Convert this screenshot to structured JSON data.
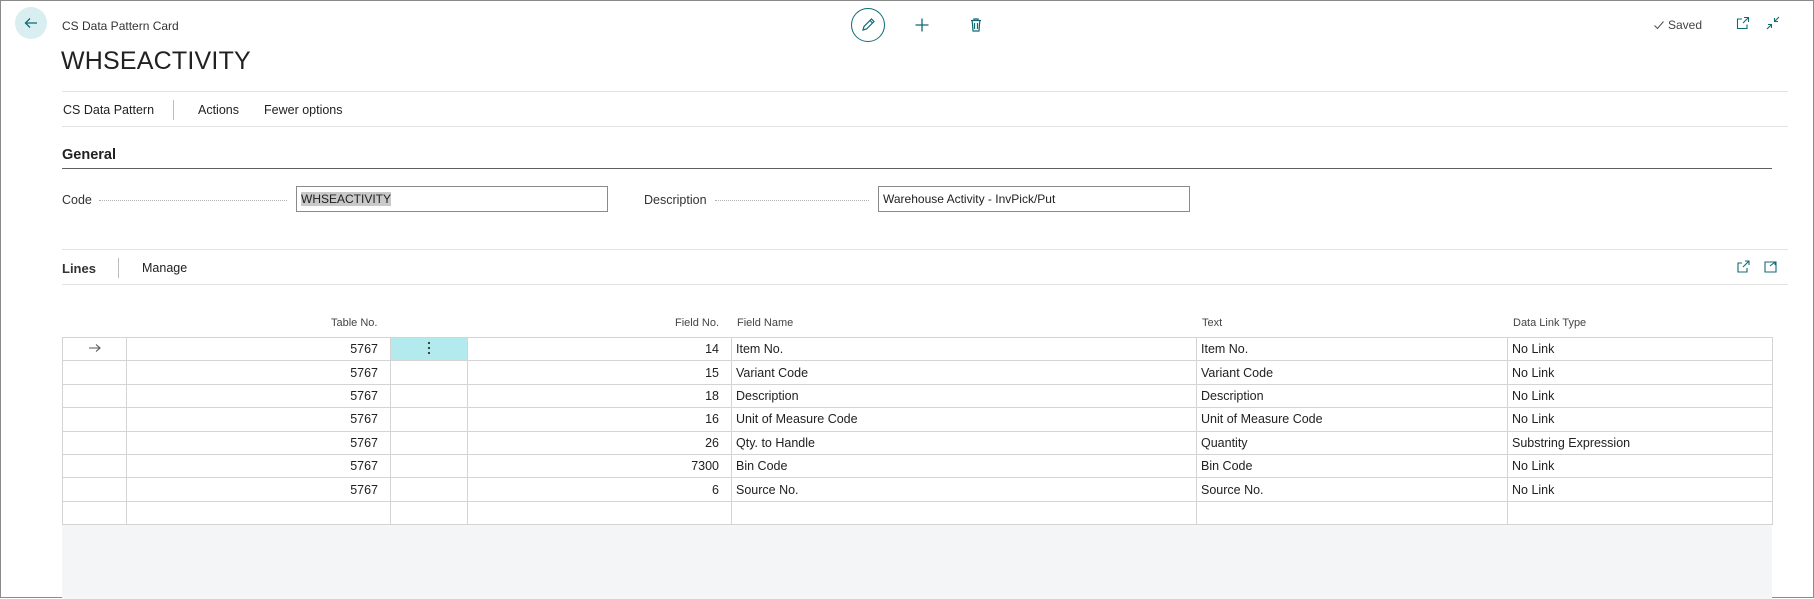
{
  "header": {
    "caption": "CS Data Pattern Card",
    "title": "WHSEACTIVITY",
    "status": "Saved"
  },
  "menu": {
    "items": [
      "CS Data Pattern",
      "Actions",
      "Fewer options"
    ]
  },
  "general": {
    "title": "General",
    "code_label": "Code",
    "code_value": "WHSEACTIVITY",
    "description_label": "Description",
    "description_value": "Warehouse Activity - InvPick/Put"
  },
  "lines": {
    "title": "Lines",
    "manage": "Manage",
    "columns": [
      "Table No.",
      "Field No.",
      "Field Name",
      "Text",
      "Data Link Type"
    ],
    "rows": [
      {
        "table_no": "5767",
        "field_no": "14",
        "field_name": "Item No.",
        "text": "Item No.",
        "link": "No Link"
      },
      {
        "table_no": "5767",
        "field_no": "15",
        "field_name": "Variant Code",
        "text": "Variant Code",
        "link": "No Link"
      },
      {
        "table_no": "5767",
        "field_no": "18",
        "field_name": "Description",
        "text": "Description",
        "link": "No Link"
      },
      {
        "table_no": "5767",
        "field_no": "16",
        "field_name": "Unit of Measure Code",
        "text": "Unit of Measure Code",
        "link": "No Link"
      },
      {
        "table_no": "5767",
        "field_no": "26",
        "field_name": "Qty. to Handle",
        "text": "Quantity",
        "link": "Substring Expression"
      },
      {
        "table_no": "5767",
        "field_no": "7300",
        "field_name": "Bin Code",
        "text": "Bin Code",
        "link": "No Link"
      },
      {
        "table_no": "5767",
        "field_no": "6",
        "field_name": "Source No.",
        "text": "Source No.",
        "link": "No Link"
      }
    ]
  },
  "colors": {
    "accent": "#0f6b74",
    "selected_cell": "#b3eaed"
  },
  "icons": {
    "back": "arrow-left-icon",
    "edit": "pencil-icon",
    "new": "plus-icon",
    "delete": "trash-icon",
    "saved": "check-icon",
    "open_new_window": "open-in-new-window-icon",
    "collapse": "collapse-icon",
    "share": "share-icon",
    "expand": "expand-icon",
    "row_marker": "arrow-right-icon",
    "row_menu": "vertical-ellipsis-icon"
  }
}
